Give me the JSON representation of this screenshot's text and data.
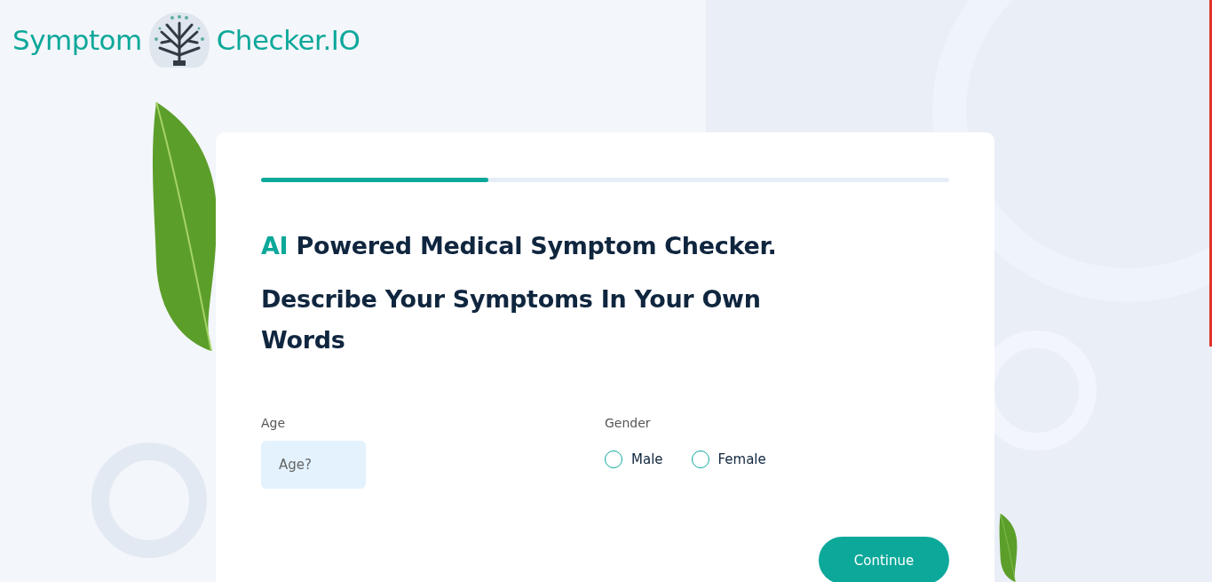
{
  "logo": {
    "left_text": "Symptom",
    "right_text": "Checker.IO"
  },
  "progress": {
    "level": 0.33
  },
  "heading": {
    "highlight": "AI",
    "rest": "Powered Medical Symptom Checker."
  },
  "subheading": "Describe Your Symptoms In Your Own Words",
  "age": {
    "label": "Age",
    "placeholder": "Age?"
  },
  "gender": {
    "label": "Gender",
    "options": [
      {
        "label": "Male",
        "selected": false
      },
      {
        "label": "Female",
        "selected": false
      }
    ]
  },
  "continue_button": "Continue"
}
